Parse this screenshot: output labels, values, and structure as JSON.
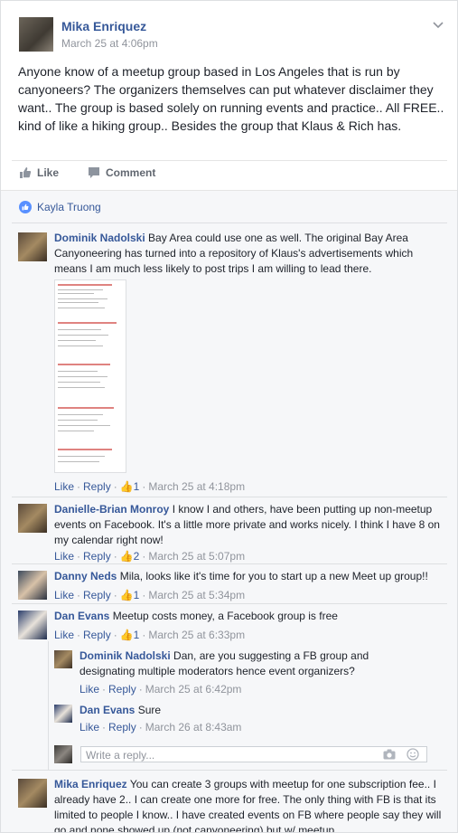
{
  "post": {
    "author": "Mika Enriquez",
    "time": "March 25 at 4:06pm",
    "text": "Anyone know of a meetup group based in Los Angeles that is run by canyoneers? The organizers themselves can put whatever disclaimer they want.. The group is based solely on running events and practice.. All FREE.. kind of like a hiking group.. Besides the group that Klaus & Rich has.",
    "like_label": "Like",
    "comment_label": "Comment"
  },
  "likes": {
    "liker": "Kayla Truong"
  },
  "comments": [
    {
      "author": "Dominik Nadolski",
      "text": "Bay Area could use one as well. The original Bay Area Canyoneering has turned into a repository of Klaus's advertisements which means I am much less likely to post trips I am willing to lead there.",
      "like": "Like",
      "reply": "Reply",
      "likes_count": "1",
      "time": "March 25 at 4:18pm"
    },
    {
      "author": "Danielle-Brian Monroy",
      "text": "I know I and others, have been putting up non-meetup events on Facebook. It's a little more private and works nicely. I think I have 8 on my calendar right now!",
      "like": "Like",
      "reply": "Reply",
      "likes_count": "2",
      "time": "March 25 at 5:07pm"
    },
    {
      "author": "Danny Neds",
      "text": "Mila, looks like it's time for you to start up a new Meet up group!!",
      "like": "Like",
      "reply": "Reply",
      "likes_count": "1",
      "time": "March 25 at 5:34pm"
    },
    {
      "author": "Dan Evans",
      "text": "Meetup costs money, a Facebook group is free",
      "like": "Like",
      "reply": "Reply",
      "likes_count": "1",
      "time": "March 25 at 6:33pm"
    }
  ],
  "replies": [
    {
      "author": "Dominik Nadolski",
      "text": "Dan, are you suggesting a FB group and designating multiple moderators hence event organizers?",
      "like": "Like",
      "reply": "Reply",
      "time": "March 25 at 6:42pm"
    },
    {
      "author": "Dan Evans",
      "text": "Sure",
      "like": "Like",
      "reply": "Reply",
      "time": "March 26 at 8:43am"
    }
  ],
  "reply_box": {
    "placeholder": "Write a reply..."
  },
  "last_comment": {
    "author": "Mika Enriquez",
    "text": "You can create 3 groups with meetup for one subscription fee.. I already have 2.. I can create one more for free. The only thing with FB is that its limited to people I know.. I have created events on FB where people say they will go and none showed up (not canyoneering) but w/ meetup."
  },
  "colors": {
    "link": "#365899",
    "meta": "#90949c",
    "like_badge": "#5890ff"
  }
}
